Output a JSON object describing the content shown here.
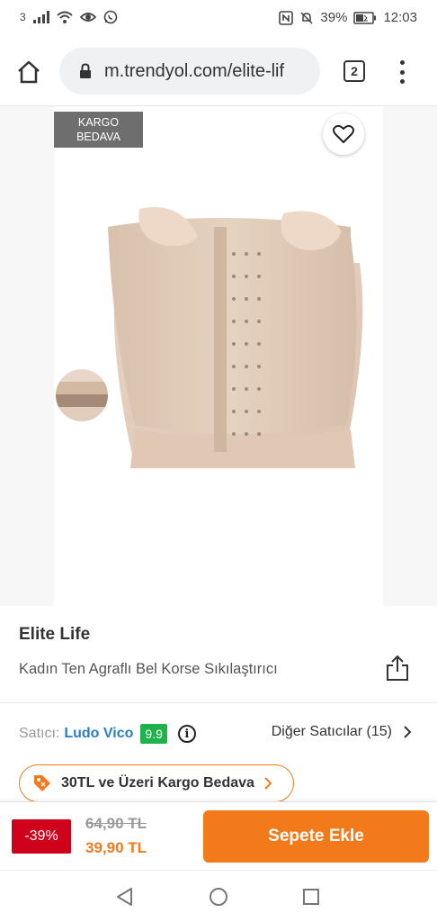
{
  "status_bar": {
    "sim_slot": "3",
    "battery": "39%",
    "time": "12:03"
  },
  "browser": {
    "url": "m.trendyol.com/elite-lif",
    "tab_count": "2"
  },
  "product_image": {
    "badge_line1": "KARGO",
    "badge_line2": "BEDAVA"
  },
  "product": {
    "brand": "Elite Life",
    "name": "Kadın Ten Agraflı Bel Korse Sıkılaştırıcı"
  },
  "seller": {
    "label": "Satıcı:",
    "name": "Ludo Vico",
    "score": "9.9",
    "other_sellers": "Diğer Satıcılar (15)"
  },
  "promo": {
    "text": "30TL ve Üzeri Kargo Bedava"
  },
  "pricing": {
    "discount": "-39%",
    "old_price": "64,90 TL",
    "new_price": "39,90 TL",
    "add_to_cart": "Sepete Ekle"
  },
  "colors": {
    "brand_orange": "#f27a1a",
    "discount_red": "#d0021b",
    "seller_blue": "#2a7ec4",
    "score_green": "#20b24a"
  },
  "icons": [
    "signal-icon",
    "wifi-icon",
    "eye-icon",
    "whatsapp-icon",
    "nfc-icon",
    "mute-icon",
    "battery-icon",
    "home-icon",
    "lock-icon",
    "tabs-icon",
    "menu-icon",
    "heart-icon",
    "share-icon",
    "info-icon",
    "chevron-right-icon",
    "tag-icon",
    "nav-back-icon",
    "nav-home-icon",
    "nav-recent-icon"
  ]
}
